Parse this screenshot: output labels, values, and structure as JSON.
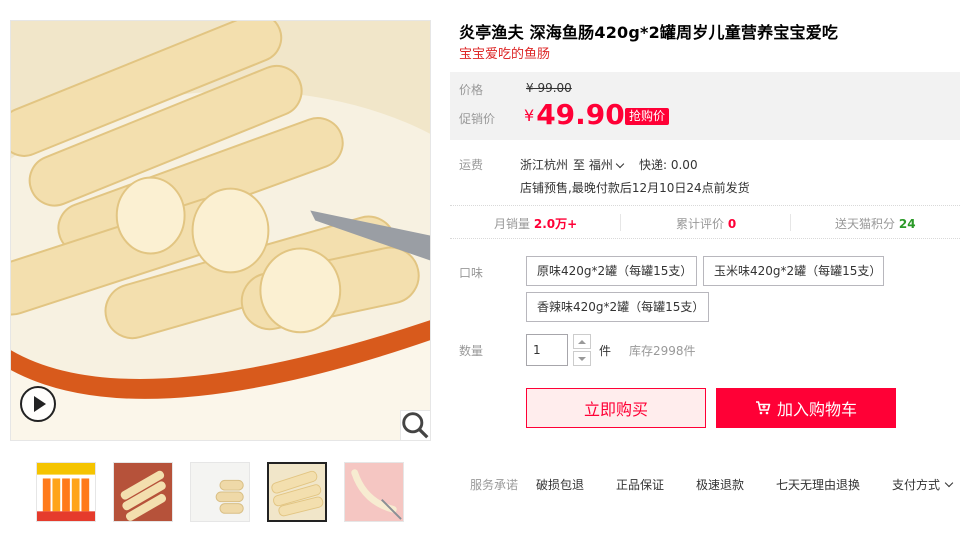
{
  "product": {
    "title": "炎亭渔夫 深海鱼肠420g*2罐周岁儿童营养宝宝爱吃",
    "subtitle": "宝宝爱吃的鱼肠"
  },
  "price": {
    "original_label": "价格",
    "original_value": "¥ 99.00",
    "promo_label": "促销价",
    "promo_currency": "¥",
    "promo_value": "49.90",
    "promo_tag": "抢购价"
  },
  "shipping": {
    "label": "运费",
    "from": "浙江杭州",
    "to_prefix": "至",
    "to_city": "福州",
    "method": "快递: 0.00",
    "note": "店铺预售,最晚付款后12月10日24点前发货"
  },
  "stats": {
    "monthly_sales_label": "月销量",
    "monthly_sales_value": "2.0万+",
    "reviews_label": "累计评价",
    "reviews_value": "0",
    "points_label": "送天猫积分",
    "points_value": "24"
  },
  "options": {
    "flavor_label": "口味",
    "flavors": [
      "原味420g*2罐（每罐15支）",
      "玉米味420g*2罐（每罐15支）",
      "香辣味420g*2罐（每罐15支）"
    ]
  },
  "quantity": {
    "label": "数量",
    "value": "1",
    "unit": "件",
    "stock": "库存2998件"
  },
  "actions": {
    "buy_now": "立即购买",
    "add_to_cart": "加入购物车"
  },
  "services": {
    "label": "服务承诺",
    "items": [
      "破损包退",
      "正品保证",
      "极速退款",
      "七天无理由退换"
    ],
    "payment": "支付方式"
  },
  "colors": {
    "accent": "#ff0036",
    "subtitle": "#dd2727",
    "points": "#2b9a28"
  }
}
